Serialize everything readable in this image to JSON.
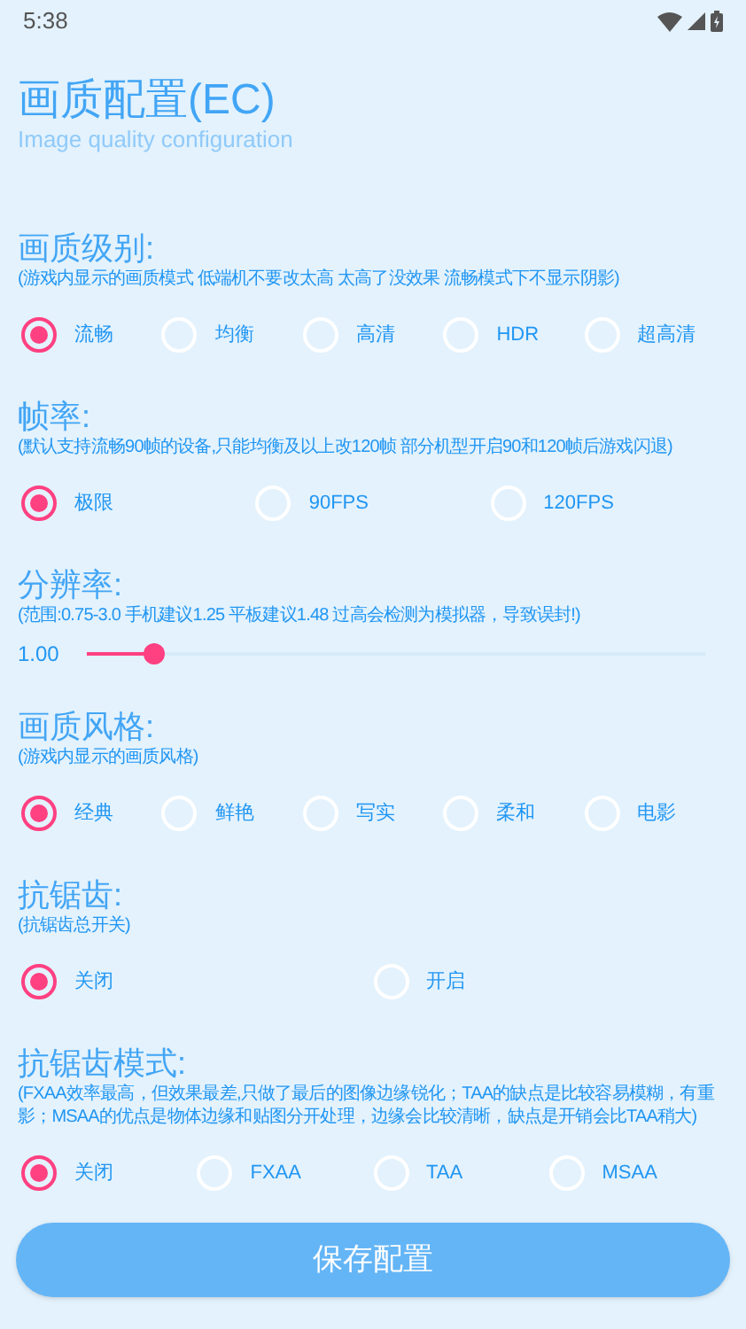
{
  "status_bar": {
    "time": "5:38"
  },
  "header": {
    "title": "画质配置(EC)",
    "subtitle": "Image quality configuration"
  },
  "sections": [
    {
      "kind": "radio",
      "title": "画质级别:",
      "description": "(游戏内显示的画质模式 低端机不要改太高 太高了没效果 流畅模式下不显示阴影)",
      "options": [
        {
          "label": "流畅",
          "selected": true
        },
        {
          "label": "均衡",
          "selected": false
        },
        {
          "label": "高清",
          "selected": false
        },
        {
          "label": "HDR",
          "selected": false
        },
        {
          "label": "超高清",
          "selected": false
        }
      ]
    },
    {
      "kind": "radio",
      "title": "帧率:",
      "description": "(默认支持流畅90帧的设备,只能均衡及以上改120帧  部分机型开启90和120帧后游戏闪退)",
      "options": [
        {
          "label": "极限",
          "selected": true
        },
        {
          "label": "90FPS",
          "selected": false
        },
        {
          "label": "120FPS",
          "selected": false
        }
      ]
    },
    {
      "kind": "slider",
      "title": "分辨率:",
      "description": "(范围:0.75-3.0  手机建议1.25 平板建议1.48  过高会检测为模拟器，导致误封!)",
      "value": "1.00",
      "level": 0.11
    },
    {
      "kind": "radio",
      "title": "画质风格:",
      "description": "(游戏内显示的画质风格)",
      "options": [
        {
          "label": "经典",
          "selected": true
        },
        {
          "label": "鲜艳",
          "selected": false
        },
        {
          "label": "写实",
          "selected": false
        },
        {
          "label": "柔和",
          "selected": false
        },
        {
          "label": "电影",
          "selected": false
        }
      ]
    },
    {
      "kind": "radio",
      "title": "抗锯齿:",
      "description": "(抗锯齿总开关)",
      "options": [
        {
          "label": "关闭",
          "selected": true
        },
        {
          "label": "开启",
          "selected": false
        }
      ]
    },
    {
      "kind": "radio",
      "title": "抗锯齿模式:",
      "description": "(FXAA效率最高，但效果最差,只做了最后的图像边缘锐化；TAA的缺点是比较容易模糊，有重影；MSAA的优点是物体边缘和贴图分开处理，边缘会比较清晰，缺点是开销会比TAA稍大)",
      "options": [
        {
          "label": "关闭",
          "selected": true
        },
        {
          "label": "FXAA",
          "selected": false
        },
        {
          "label": "TAA",
          "selected": false
        },
        {
          "label": "MSAA",
          "selected": false
        }
      ]
    }
  ],
  "save_button": {
    "label": "保存配置"
  }
}
